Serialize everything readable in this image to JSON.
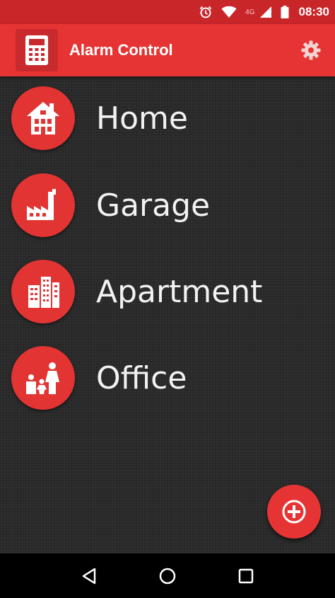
{
  "status_bar": {
    "network": "4G",
    "time": "08:30",
    "icons": [
      "alarm-clock-icon",
      "wifi-icon",
      "signal-icon",
      "battery-icon"
    ]
  },
  "app_bar": {
    "title": "Alarm Control",
    "app_icon": "calculator-keypad-icon",
    "settings_icon": "gear-icon"
  },
  "locations": [
    {
      "label": "Home",
      "icon": "house-icon"
    },
    {
      "label": "Garage",
      "icon": "factory-icon"
    },
    {
      "label": "Apartment",
      "icon": "apartment-building-icon"
    },
    {
      "label": "Office",
      "icon": "family-icon"
    }
  ],
  "fab": {
    "icon": "add-circle-icon"
  },
  "navigation": {
    "buttons": [
      "back-icon",
      "home-icon",
      "recents-icon"
    ]
  },
  "colors": {
    "primary": "#e63434",
    "primary_dark": "#c9262a",
    "background": "#2b2b2b",
    "text": "#f2f2f2"
  }
}
